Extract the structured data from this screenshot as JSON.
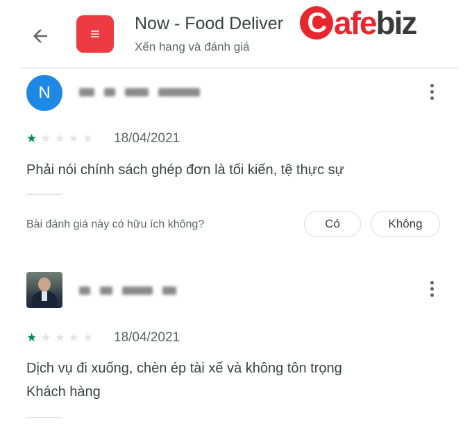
{
  "header": {
    "back_icon": "arrow-back-icon",
    "app_icon": "now-app-icon",
    "app_icon_color": "#ee3a43",
    "title": "Now - Food Deliver",
    "subtitle": "Xến hang và đánh giá"
  },
  "watermark": {
    "c": "C",
    "red_part": "afe",
    "gray_part": "biz"
  },
  "reviews": [
    {
      "avatar_letter": "N",
      "avatar_color": "#1e88e5",
      "rating": 1,
      "max_rating": 5,
      "date": "18/04/2021",
      "text": "Phải nói chính sách ghép đơn là tối kiến, tệ thực sự",
      "more_icon": "more-vert-icon"
    },
    {
      "avatar_icon": "user-photo-avatar",
      "rating": 1,
      "max_rating": 5,
      "date": "18/04/2021",
      "text_lines": [
        "Dịch vụ đi xuống, chèn ép tài xế và không tôn trọng",
        "Khách hàng"
      ],
      "more_icon": "more-vert-icon"
    }
  ],
  "helpful": {
    "question": "Bài đánh giá này có hữu ích không?",
    "yes_label": "Có",
    "no_label": "Không"
  },
  "colors": {
    "star_filled": "#01875f",
    "star_empty": "#e4e4e4",
    "brand_red": "#e8262d"
  }
}
